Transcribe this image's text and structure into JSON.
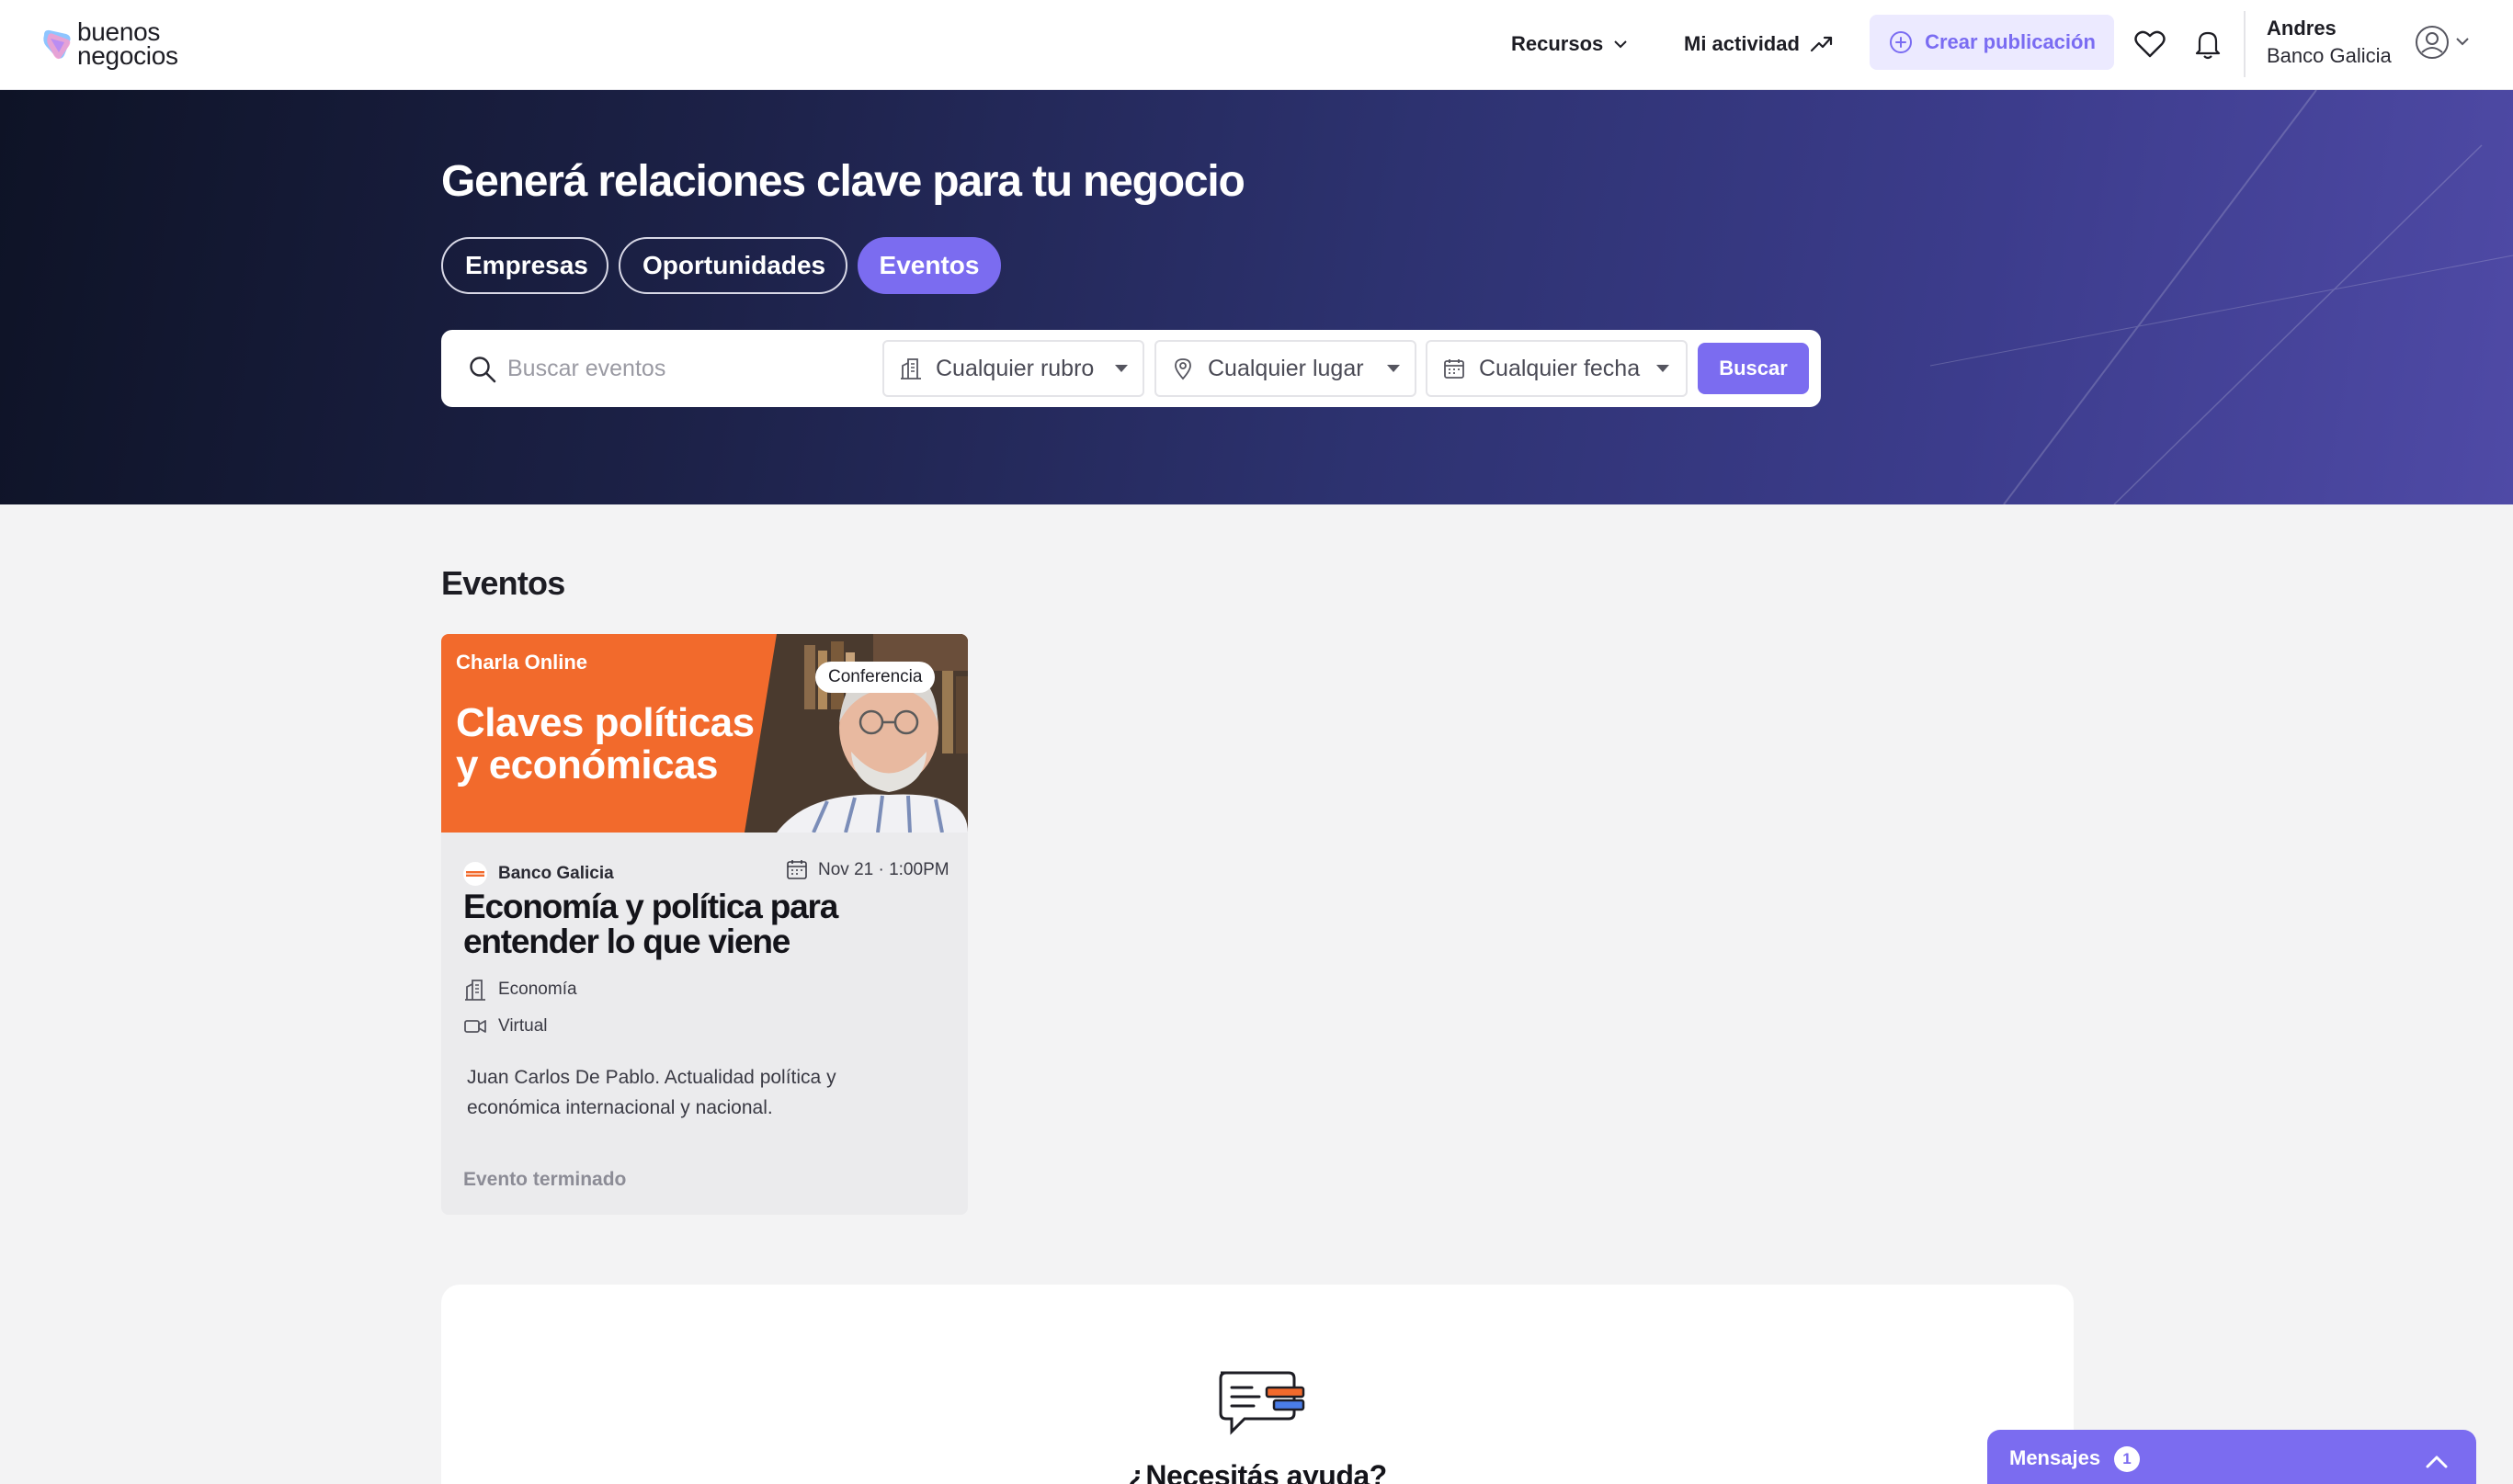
{
  "header": {
    "logo_line1": "buenos",
    "logo_line2": "negocios",
    "nav": {
      "recursos": "Recursos",
      "actividad": "Mi actividad"
    },
    "create_label": "Crear publicación",
    "user": {
      "name": "Andres",
      "company": "Banco Galicia"
    }
  },
  "hero": {
    "title": "Generá relaciones clave para tu negocio",
    "tabs": [
      "Empresas",
      "Oportunidades",
      "Eventos"
    ],
    "active_tab": "Eventos",
    "search": {
      "placeholder": "Buscar eventos",
      "rubro": "Cualquier rubro",
      "lugar": "Cualquier lugar",
      "fecha": "Cualquier fecha",
      "button": "Buscar"
    }
  },
  "section_title": "Eventos",
  "event": {
    "banner_kicker": "Charla Online",
    "banner_headline": "Claves políticas y económicas",
    "badge": "Conferencia",
    "org": "Banco Galicia",
    "date": "Nov 21 · 1:00PM",
    "title": "Economía y política para entender lo que viene",
    "sector": "Economía",
    "mode": "Virtual",
    "description": "Juan Carlos De Pablo. Actualidad política y económica internacional y nacional.",
    "status": "Evento terminado"
  },
  "help": {
    "title": "¿Necesitás ayuda?"
  },
  "messages": {
    "label": "Mensajes",
    "count": "1"
  },
  "colors": {
    "accent": "#7b6cf0",
    "banner_orange": "#f26a2c",
    "hero_dark": "#0e1326"
  }
}
